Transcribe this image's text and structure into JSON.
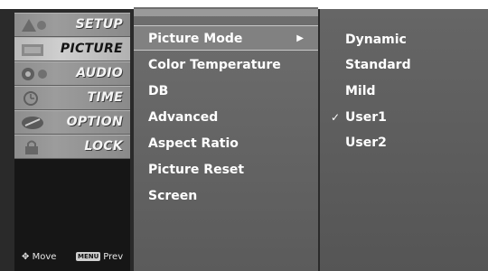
{
  "sidebar": {
    "items": [
      {
        "label": "SETUP",
        "icon": "satellite-icon",
        "selected": false
      },
      {
        "label": "PICTURE",
        "icon": "picture-icon",
        "selected": true
      },
      {
        "label": "AUDIO",
        "icon": "speaker-icon",
        "selected": false
      },
      {
        "label": "TIME",
        "icon": "clock-icon",
        "selected": false
      },
      {
        "label": "OPTION",
        "icon": "option-icon",
        "selected": false
      },
      {
        "label": "LOCK",
        "icon": "lock-icon",
        "selected": false
      }
    ],
    "hint": {
      "move_label": "Move",
      "menu_key": "MENU",
      "prev_label": "Prev"
    }
  },
  "submenu": {
    "items": [
      {
        "label": "Picture Mode",
        "highlighted": true,
        "has_arrow": true
      },
      {
        "label": "Color Temperature"
      },
      {
        "label": "DB"
      },
      {
        "label": "Advanced"
      },
      {
        "label": "Aspect Ratio"
      },
      {
        "label": "Picture Reset"
      },
      {
        "label": "Screen"
      }
    ],
    "arrow_glyph": "▶"
  },
  "options": {
    "items": [
      {
        "label": "Dynamic",
        "checked": false
      },
      {
        "label": "Standard",
        "checked": false
      },
      {
        "label": "Mild",
        "checked": false
      },
      {
        "label": "User1",
        "checked": true
      },
      {
        "label": "User2",
        "checked": false
      }
    ],
    "check_glyph": "✓"
  }
}
